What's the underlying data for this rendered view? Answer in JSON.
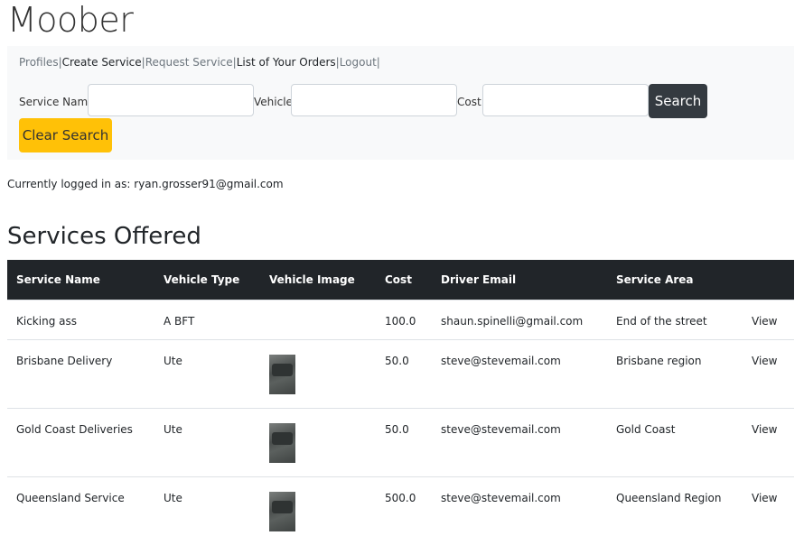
{
  "app": {
    "title": "Moober"
  },
  "nav": {
    "items": [
      {
        "label": "Profiles",
        "style": "muted"
      },
      {
        "label": "Create Service",
        "style": "dark"
      },
      {
        "label": "Request Service",
        "style": "muted"
      },
      {
        "label": "List of Your Orders",
        "style": "dark"
      },
      {
        "label": "Logout",
        "style": "muted"
      }
    ],
    "separator": "|"
  },
  "search": {
    "service_name_label": "Service Name:",
    "service_name_value": "",
    "vehicle_label": "Vehicle:",
    "vehicle_value": "",
    "cost_label": "Cost:",
    "cost_value": "",
    "search_button": "Search",
    "clear_button": "Clear Search"
  },
  "session": {
    "logged_in_text": "Currently logged in as: ryan.grosser91@gmail.com"
  },
  "services": {
    "heading": "Services Offered",
    "columns": [
      "Service Name",
      "Vehicle Type",
      "Vehicle Image",
      "Cost",
      "Driver Email",
      "Service Area",
      ""
    ],
    "rows": [
      {
        "name": "Kicking ass",
        "vehicle": "A BFT",
        "has_image": false,
        "cost": "100.0",
        "email": "shaun.spinelli@gmail.com",
        "area": "End of the street",
        "action": "View"
      },
      {
        "name": "Brisbane Delivery",
        "vehicle": "Ute",
        "has_image": true,
        "cost": "50.0",
        "email": "steve@stevemail.com",
        "area": "Brisbane region",
        "action": "View"
      },
      {
        "name": "Gold Coast Deliveries",
        "vehicle": "Ute",
        "has_image": true,
        "cost": "50.0",
        "email": "steve@stevemail.com",
        "area": "Gold Coast",
        "action": "View"
      },
      {
        "name": "Queensland Service",
        "vehicle": "Ute",
        "has_image": true,
        "cost": "500.0",
        "email": "steve@stevemail.com",
        "area": "Queensland Region",
        "action": "View"
      }
    ]
  },
  "colors": {
    "header_bg": "#212529",
    "panel_bg": "#f8f9fa",
    "search_btn": "#343a40",
    "clear_btn": "#ffc107"
  }
}
